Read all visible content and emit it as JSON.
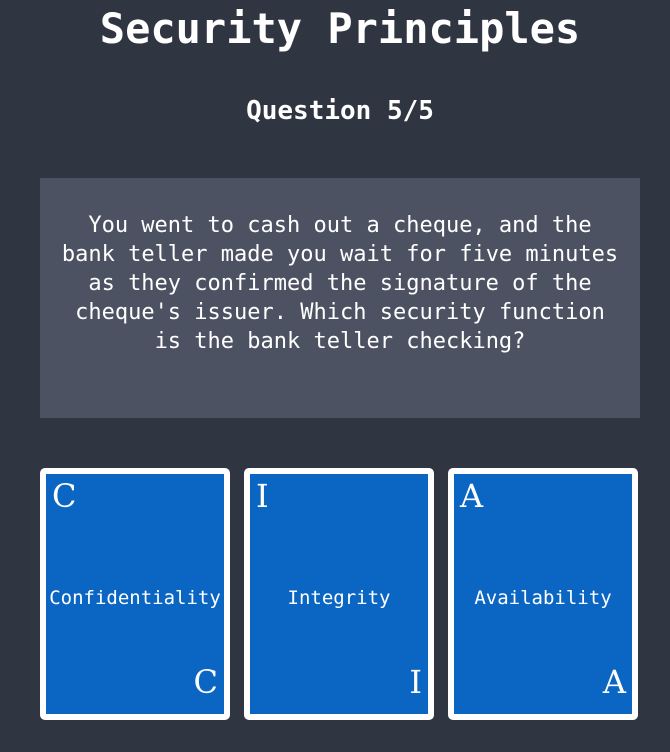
{
  "title": "Security Principles",
  "question_counter": "Question 5/5",
  "question_text": "You went to cash out a cheque, and the bank teller made you wait for five minutes as they confirmed the signature of the cheque's issuer. Which security function is the bank teller checking?",
  "cards": [
    {
      "letter": "C",
      "label": "Confidentiality"
    },
    {
      "letter": "I",
      "label": "Integrity"
    },
    {
      "letter": "A",
      "label": "Availability"
    }
  ],
  "colors": {
    "background": "#303542",
    "question_box": "#4c5262",
    "card": "#0a66c2",
    "card_border": "#ffffff"
  }
}
